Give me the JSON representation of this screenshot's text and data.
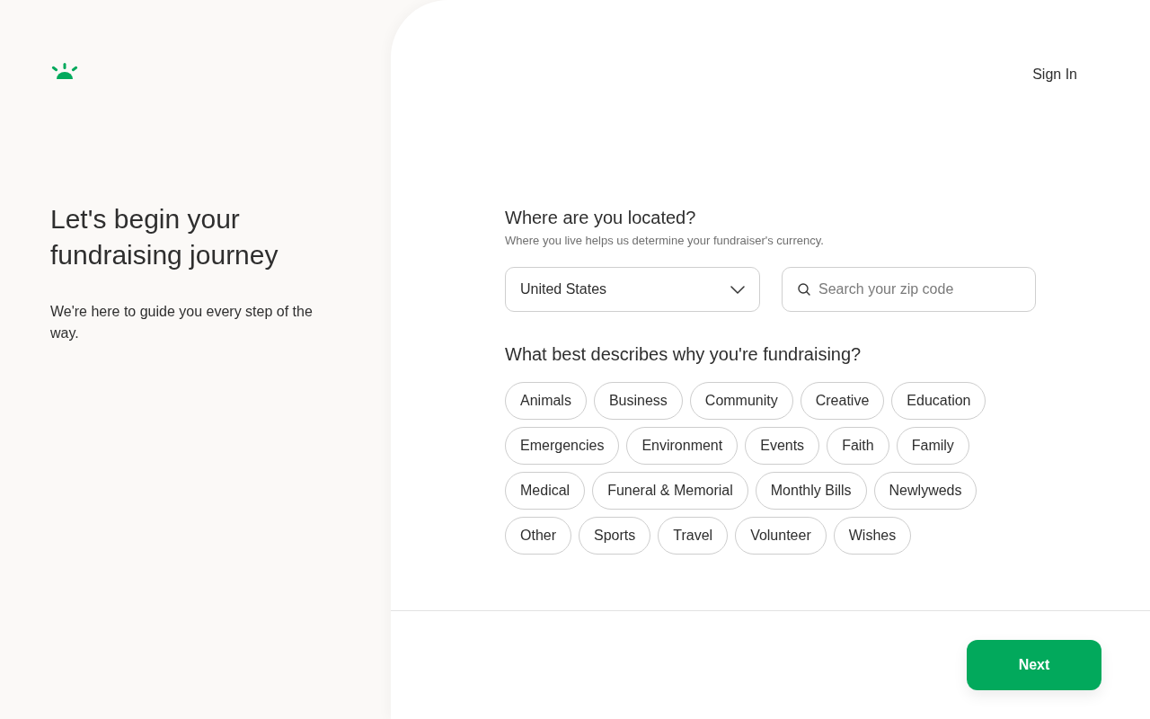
{
  "intro": {
    "title": "Let's begin your fundraising journey",
    "text": "We're here to guide you every step of the way."
  },
  "header": {
    "sign_in": "Sign In"
  },
  "location": {
    "question": "Where are you located?",
    "hint": "Where you live helps us determine your fundraiser's currency.",
    "country": {
      "value": "United States"
    },
    "zip": {
      "placeholder": "Search your zip code"
    }
  },
  "categories": {
    "question": "What best describes why you're fundraising?",
    "items": [
      {
        "label": "Animals",
        "selected": false
      },
      {
        "label": "Business",
        "selected": false
      },
      {
        "label": "Community",
        "selected": false
      },
      {
        "label": "Creative",
        "selected": false
      },
      {
        "label": "Education",
        "selected": false
      },
      {
        "label": "Emergencies",
        "selected": false
      },
      {
        "label": "Environment",
        "selected": false
      },
      {
        "label": "Events",
        "selected": false
      },
      {
        "label": "Faith",
        "selected": false
      },
      {
        "label": "Family",
        "selected": false
      },
      {
        "label": "Medical",
        "selected": false
      },
      {
        "label": "Funeral & Memorial",
        "selected": false
      },
      {
        "label": "Monthly Bills",
        "selected": false
      },
      {
        "label": "Newlyweds",
        "selected": false
      },
      {
        "label": "Other",
        "selected": false
      },
      {
        "label": "Sports",
        "selected": false
      },
      {
        "label": "Travel",
        "selected": false
      },
      {
        "label": "Volunteer",
        "selected": false
      },
      {
        "label": "Wishes",
        "selected": false
      }
    ]
  },
  "footer": {
    "next": "Next"
  }
}
